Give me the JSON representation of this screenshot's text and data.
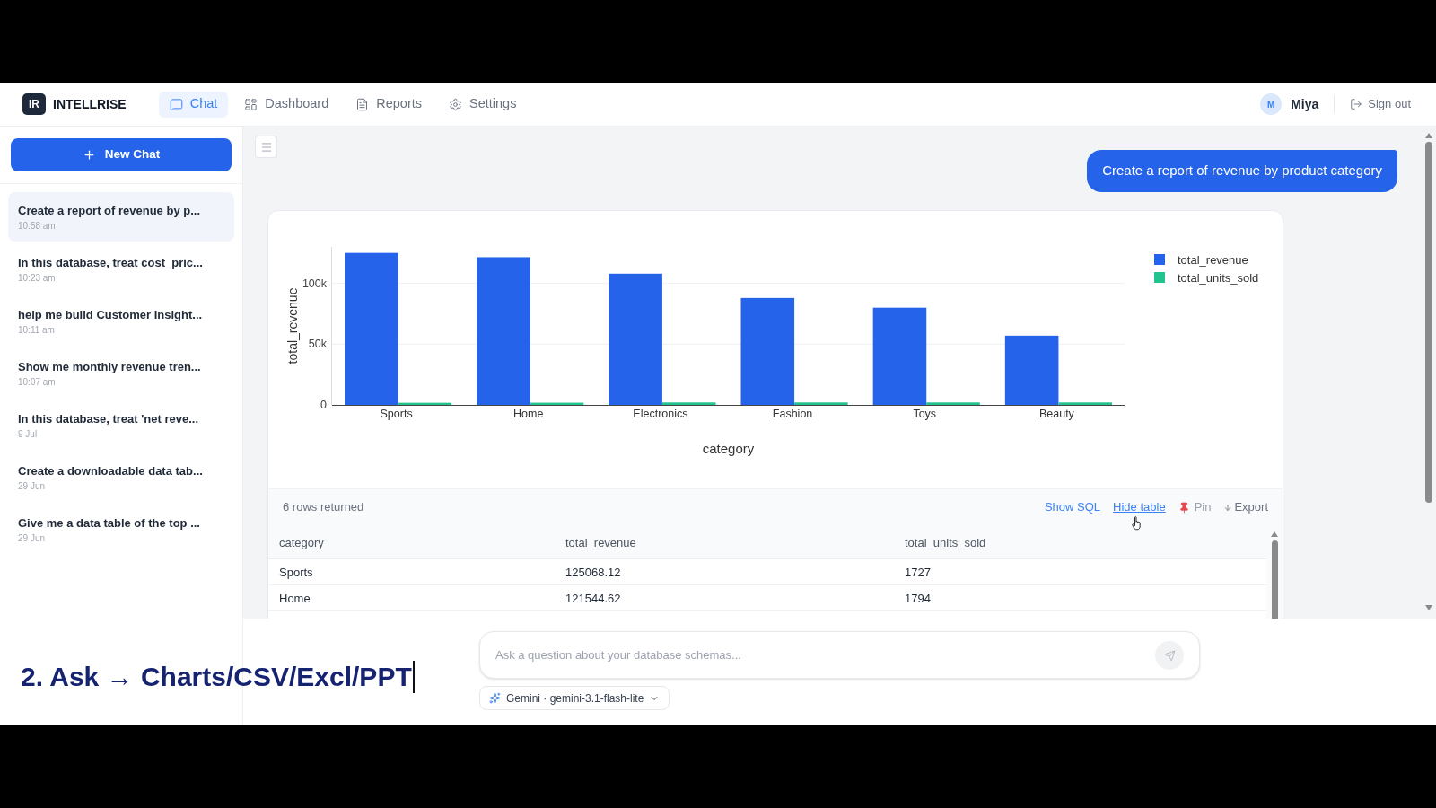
{
  "header": {
    "logo": {
      "mark": "IR",
      "name": "INTELLRISE"
    },
    "tabs": [
      {
        "label": "Chat",
        "selected": true
      },
      {
        "label": "Dashboard",
        "selected": false
      },
      {
        "label": "Reports",
        "selected": false
      },
      {
        "label": "Settings",
        "selected": false
      }
    ],
    "user": {
      "initial": "M",
      "name": "Miya"
    },
    "sign_out": "Sign out"
  },
  "sidebar": {
    "new_chat": "New Chat",
    "chats": [
      {
        "title": "Create a report of revenue by p...",
        "time": "10:58 am",
        "selected": true
      },
      {
        "title": "In this database, treat cost_pric...",
        "time": "10:23 am",
        "selected": false
      },
      {
        "title": "help me build Customer Insight...",
        "time": "10:11 am",
        "selected": false
      },
      {
        "title": "Show me monthly revenue tren...",
        "time": "10:07 am",
        "selected": false
      },
      {
        "title": "In this database, treat 'net reve...",
        "time": "9 Jul",
        "selected": false
      },
      {
        "title": "Create a downloadable data tab...",
        "time": "29 Jun",
        "selected": false
      },
      {
        "title": "Give me a data table of the top ...",
        "time": "29 Jun",
        "selected": false
      }
    ]
  },
  "conversation": {
    "user_message": "Create a report of revenue by product category",
    "result": {
      "chart_data": {
        "type": "bar",
        "xlabel": "category",
        "ylabel": "total_revenue",
        "categories": [
          "Sports",
          "Home",
          "Electronics",
          "Fashion",
          "Toys",
          "Beauty"
        ],
        "series": [
          {
            "name": "total_revenue",
            "color": "#2563eb",
            "values": [
              125068.12,
              121544.62,
              108000,
              88000,
              80000,
              57000
            ]
          },
          {
            "name": "total_units_sold",
            "color": "#22c38e",
            "values": [
              1727,
              1794,
              2000,
              2000,
              2000,
              2000
            ]
          }
        ],
        "ylim": [
          0,
          130000
        ],
        "yticks": [
          {
            "value": 0,
            "label": "0"
          },
          {
            "value": 50000,
            "label": "50k"
          },
          {
            "value": 100000,
            "label": "100k"
          }
        ],
        "legend": "right"
      },
      "rows_returned": "6 rows returned",
      "actions": [
        {
          "label": "Show SQL",
          "kind": "link",
          "hovered": false
        },
        {
          "label": "Hide table",
          "kind": "link",
          "hovered": true
        },
        {
          "label": "Pin",
          "kind": "pin",
          "hovered": false
        },
        {
          "label": "Export",
          "kind": "export",
          "hovered": false
        }
      ],
      "table": {
        "columns": [
          "category",
          "total_revenue",
          "total_units_sold"
        ],
        "rows": [
          [
            "Sports",
            "125068.12",
            "1727"
          ],
          [
            "Home",
            "121544.62",
            "1794"
          ]
        ]
      }
    }
  },
  "composer": {
    "placeholder": "Ask a question about your database schemas...",
    "model": "Gemini · gemini-3.1-flash-lite"
  },
  "caption": "2. Ask → Charts/CSV/Excl/PPT"
}
